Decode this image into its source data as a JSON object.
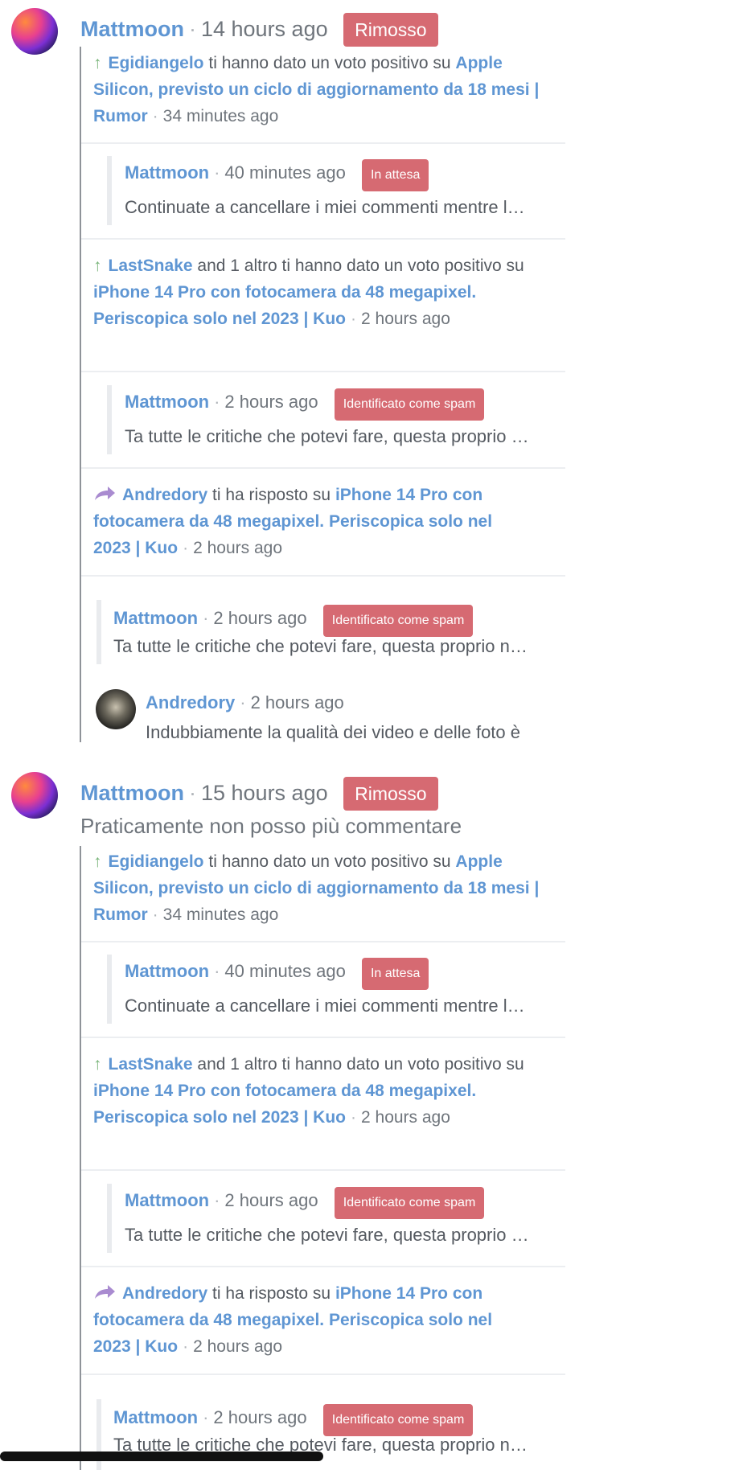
{
  "block1": {
    "header": {
      "user": "Mattmoon",
      "time": "14 hours ago",
      "badge": "Rimosso"
    },
    "n1": {
      "user": "Egidiangelo",
      "text": "ti hanno dato un voto positivo su",
      "link": "Apple Silicon, previsto un ciclo di aggiornamento da 18 mesi | Rumor",
      "time": "34 minutes ago"
    },
    "q1": {
      "user": "Mattmoon",
      "time": "40 minutes ago",
      "badge": "In attesa",
      "excerpt": "Continuate a cancellare i miei commenti mentre l…"
    },
    "n2": {
      "user": "LastSnake",
      "text": "and 1 altro ti hanno dato un voto positivo su",
      "link": "iPhone 14 Pro con fotocamera da 48 megapixel. Periscopica solo nel 2023 | Kuo",
      "time": "2 hours ago"
    },
    "q2": {
      "user": "Mattmoon",
      "time": "2 hours ago",
      "badge": "Identificato come spam",
      "excerpt": "Ta tutte le critiche che potevi fare, questa proprio …"
    },
    "n3": {
      "user": "Andredory",
      "text": "ti ha risposto su",
      "link": "iPhone 14 Pro con fotocamera da 48 megapixel. Periscopica solo nel 2023 | Kuo",
      "time": "2 hours ago"
    },
    "q3": {
      "user": "Mattmoon",
      "time": "2 hours ago",
      "badge": "Identificato come spam",
      "excerpt": "Ta tutte le critiche che potevi fare, questa proprio n…"
    },
    "reply": {
      "user": "Andredory",
      "time": "2 hours ago",
      "excerpt": "Indubbiamente la qualità dei video e delle foto è"
    }
  },
  "block2": {
    "header": {
      "user": "Mattmoon",
      "time": "15 hours ago",
      "badge": "Rimosso"
    },
    "comment": "Praticamente non posso più commentare",
    "n1": {
      "user": "Egidiangelo",
      "text": "ti hanno dato un voto positivo su",
      "link": "Apple Silicon, previsto un ciclo di aggiornamento da 18 mesi | Rumor",
      "time": "34 minutes ago"
    },
    "q1": {
      "user": "Mattmoon",
      "time": "40 minutes ago",
      "badge": "In attesa",
      "excerpt": "Continuate a cancellare i miei commenti mentre l…"
    },
    "n2": {
      "user": "LastSnake",
      "text": "and 1 altro ti hanno dato un voto positivo su",
      "link": "iPhone 14 Pro con fotocamera da 48 megapixel. Periscopica solo nel 2023 | Kuo",
      "time": "2 hours ago"
    },
    "q2": {
      "user": "Mattmoon",
      "time": "2 hours ago",
      "badge": "Identificato come spam",
      "excerpt": "Ta tutte le critiche che potevi fare, questa proprio …"
    },
    "n3": {
      "user": "Andredory",
      "text": "ti ha risposto su",
      "link": "iPhone 14 Pro con fotocamera da 48 megapixel. Periscopica solo nel 2023 | Kuo",
      "time": "2 hours ago"
    },
    "q3": {
      "user": "Mattmoon",
      "time": "2 hours ago",
      "badge": "Identificato come spam",
      "excerpt": "Ta tutte le critiche che potevi fare, questa proprio n…"
    }
  },
  "icons": {
    "upvote": "arrow-up-icon",
    "reply": "reply-arrow-icon"
  },
  "colors": {
    "accent": "#5f96d3",
    "badge": "#d66a72",
    "upvote": "#79b57a",
    "reply": "#a98bd0"
  }
}
